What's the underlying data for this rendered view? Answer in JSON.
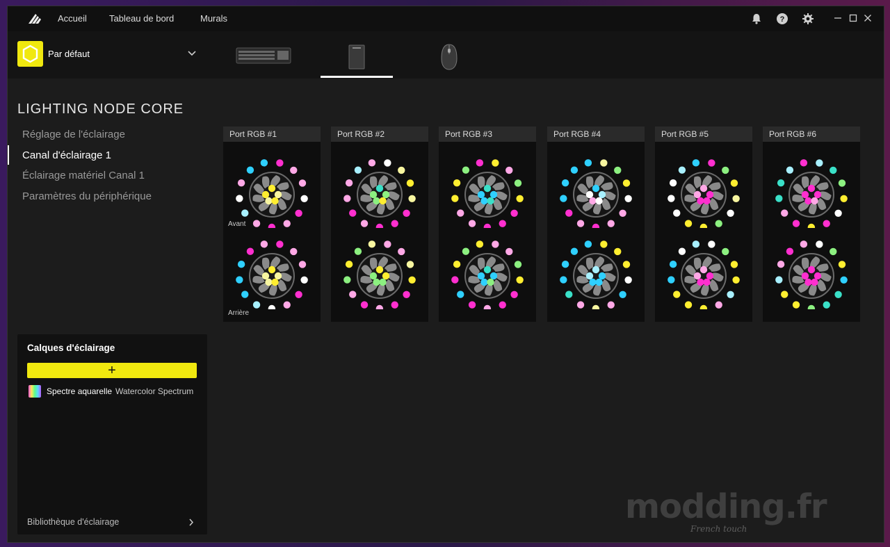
{
  "topbar": {
    "nav": [
      "Accueil",
      "Tableau de bord",
      "Murals"
    ],
    "icons": [
      "notification-bell-icon",
      "help-icon",
      "settings-gear-icon"
    ],
    "window_controls": [
      "minimize-icon",
      "maximize-icon",
      "close-icon"
    ]
  },
  "profile": {
    "name": "Par défaut",
    "icon": "profile-hex-icon",
    "accent": "#f0e80f"
  },
  "devices": [
    "keyboard",
    "lighting-node-core",
    "mouse"
  ],
  "selected_device": "lighting-node-core",
  "page_title": "LIGHTING NODE CORE",
  "sidebar": {
    "items": [
      {
        "label": "Réglage de l'éclairage",
        "active": false
      },
      {
        "label": "Canal d'éclairage 1",
        "active": true
      },
      {
        "label": "Éclairage matériel Canal 1",
        "active": false
      },
      {
        "label": "Paramètres du périphérique",
        "active": false
      }
    ]
  },
  "layers": {
    "title": "Calques d'éclairage",
    "add_label": "+",
    "items": [
      {
        "name": "Spectre aquarelle",
        "sub": "Watercolor Spectrum"
      }
    ],
    "library_label": "Bibliothèque d'éclairage"
  },
  "fan_labels": {
    "front": "Avant",
    "rear": "Arrière"
  },
  "colors": {
    "W": "#ffffff",
    "P": "#ffa8e6",
    "M": "#ff2fcf",
    "C": "#2fd0ff",
    "L": "#a8f0ff",
    "Y": "#ffee30",
    "V": "#f8f6a0",
    "G": "#8cf080",
    "T": "#3ae0c8",
    "accent": "#f0e80f"
  },
  "ports": [
    {
      "label": "Port RGB #1",
      "fans": [
        {
          "outer": "MPPWMPMPLWPCC",
          "inner": "YYVVY"
        },
        {
          "outer": "MPPWMPWLCCCMP",
          "inner": "YVVVY"
        }
      ]
    },
    {
      "label": "Port RGB #2",
      "fans": [
        {
          "outer": "WVYVMMMPMPPLP",
          "inner": "TGGGY"
        },
        {
          "outer": "PPVYMMPMPGYGV",
          "inner": "YGYGG"
        }
      ]
    },
    {
      "label": "Port RGB #3",
      "fans": [
        {
          "outer": "YPGYMMMPPYYGM",
          "inner": "TCCCT"
        },
        {
          "outer": "PPGYMMPMCMYGY",
          "inner": "TCCCG"
        }
      ]
    },
    {
      "label": "Port RGB #4",
      "fans": [
        {
          "outer": "VGYWPPMPMCCCC",
          "inner": "CWLPW"
        },
        {
          "outer": "YYYWCPVPTCCCC",
          "inner": "LLCCC"
        }
      ]
    },
    {
      "label": "Port RGB #5",
      "fans": [
        {
          "outer": "MGYVWGYYWWWLC",
          "inner": "PPMMM"
        },
        {
          "outer": "WGYYLPYYYCCWL",
          "inner": "PPMMM"
        }
      ]
    },
    {
      "label": "Port RGB #6",
      "fans": [
        {
          "outer": "LTGYWMYMPTTLM",
          "inner": "MMMMP"
        },
        {
          "outer": "WGYCTTGYYLPMP",
          "inner": "MMMMM"
        }
      ]
    }
  ],
  "watermark": {
    "main": "modding.fr",
    "sub": "French touch"
  }
}
